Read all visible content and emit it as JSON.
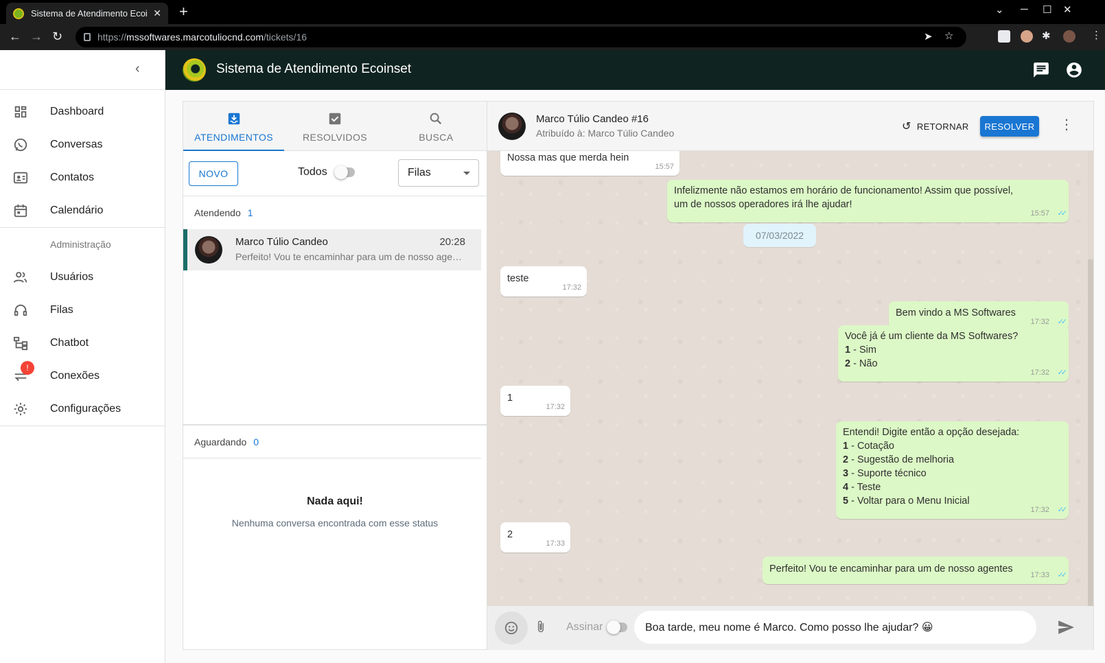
{
  "browser": {
    "tab_title": "Sistema de Atendimento Ecoinset",
    "tab_close": "✕",
    "new_tab": "+",
    "url_scheme": "https://",
    "url_host": "mssoftwares.marcotuliocnd.com",
    "url_path": "/tickets/16"
  },
  "app": {
    "title": "Sistema de Atendimento Ecoinset",
    "brand_color": "#0f2420",
    "accent_color": "#1976d2"
  },
  "sidebar": {
    "items": [
      {
        "label": "Dashboard",
        "icon": "dashboard-icon"
      },
      {
        "label": "Conversas",
        "icon": "whatsapp-icon"
      },
      {
        "label": "Contatos",
        "icon": "contacts-icon"
      },
      {
        "label": "Calendário",
        "icon": "calendar-icon"
      }
    ],
    "admin_header": "Administração",
    "admin_items": [
      {
        "label": "Usuários",
        "icon": "users-icon"
      },
      {
        "label": "Filas",
        "icon": "headset-icon"
      },
      {
        "label": "Chatbot",
        "icon": "chatbot-icon"
      },
      {
        "label": "Conexões",
        "icon": "connections-icon",
        "badge": "!"
      },
      {
        "label": "Configurações",
        "icon": "settings-icon"
      }
    ]
  },
  "tickets": {
    "tabs": [
      {
        "label": "ATENDIMENTOS",
        "active": true
      },
      {
        "label": "RESOLVIDOS",
        "active": false
      },
      {
        "label": "BUSCA",
        "active": false
      }
    ],
    "novo_label": "NOVO",
    "todos_label": "Todos",
    "filas_label": "Filas",
    "atendendo": {
      "label": "Atendendo",
      "count": "1"
    },
    "aguardando": {
      "label": "Aguardando",
      "count": "0"
    },
    "ticket": {
      "name": "Marco Túlio Candeo",
      "time": "20:28",
      "preview": "Perfeito! Vou te encaminhar para um de nosso agentes"
    },
    "empty_title": "Nada aqui!",
    "empty_subtitle": "Nenhuma conversa encontrada com esse status"
  },
  "chat": {
    "contact_name": "Marco Túlio Candeo #16",
    "assigned": "Atribuído à: Marco Túlio Candeo",
    "retornar_label": "RETORNAR",
    "resolver_label": "RESOLVER",
    "date_chip": "07/03/2022",
    "messages": [
      {
        "dir": "in",
        "lines": [
          "Nossa mas que merda hein"
        ],
        "time": "15:57"
      },
      {
        "dir": "out",
        "lines": [
          "Infelizmente não estamos em horário de funcionamento! Assim que possível,",
          "um de nossos operadores irá lhe ajudar!"
        ],
        "time": "15:57"
      },
      {
        "dir": "in",
        "lines": [
          "teste"
        ],
        "time": "17:32"
      },
      {
        "dir": "out",
        "lines": [
          "Bem vindo a MS Softwares"
        ],
        "time": "17:32"
      },
      {
        "dir": "out",
        "lines": [
          "Você já é um cliente da MS Softwares?"
        ],
        "options": [
          [
            "1",
            " - Sim"
          ],
          [
            "2",
            " - Não"
          ]
        ],
        "time": "17:32"
      },
      {
        "dir": "in",
        "lines": [
          "1"
        ],
        "time": "17:32"
      },
      {
        "dir": "out",
        "lines": [
          "Entendi! Digite então a opção desejada:"
        ],
        "options": [
          [
            "1",
            " - Cotação"
          ],
          [
            "2",
            " - Sugestão de melhoria"
          ],
          [
            "3",
            " - Suporte técnico"
          ],
          [
            "4",
            " - Teste"
          ],
          [
            "5",
            " - Voltar para o Menu Inicial"
          ]
        ],
        "time": "17:32"
      },
      {
        "dir": "in",
        "lines": [
          "2"
        ],
        "time": "17:33"
      },
      {
        "dir": "out",
        "lines": [
          "Perfeito! Vou te encaminhar para um de nosso agentes"
        ],
        "time": "17:33"
      }
    ],
    "assinar_label": "Assinar",
    "input_value": "Boa tarde, meu nome é Marco. Como posso lhe ajudar? 😀"
  }
}
